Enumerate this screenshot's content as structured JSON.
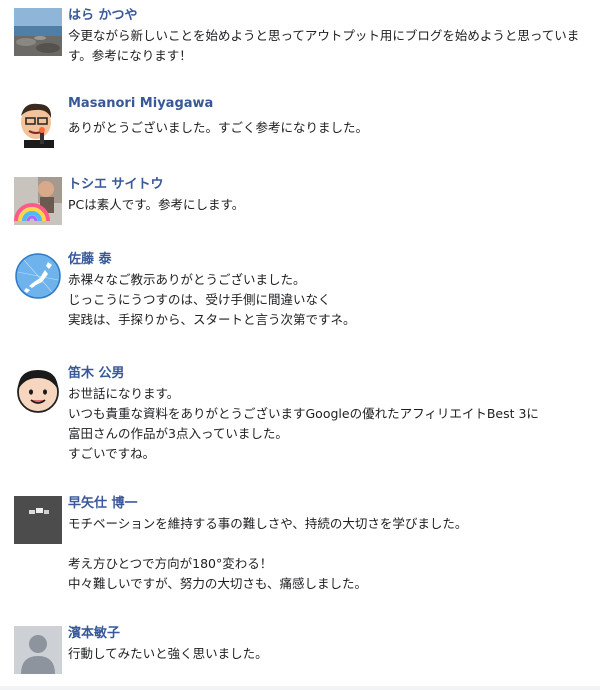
{
  "comments": [
    {
      "name": "はら かつや",
      "lines": [
        "今更ながら新しいことを始めようと思ってアウトプット用にブログを始めようと思っています。参考になります！"
      ]
    },
    {
      "name": "Masanori Miyagawa",
      "lines": [
        "ありがとうございました。すごく参考になりました。"
      ]
    },
    {
      "name": "トシエ サイトウ",
      "lines": [
        "PCは素人です。参考にします。"
      ]
    },
    {
      "name": "佐藤 泰",
      "lines": [
        "赤裸々なご教示ありがとうございました。",
        "じっこうにうつすのは、受け手側に間違いなく",
        "実践は、手探りから、スタートと言う次第ですネ。"
      ]
    },
    {
      "name": "笛木 公男",
      "lines": [
        "お世話になります。",
        "いつも貴重な資料をありがとうございますGoogleの優れたアフィリエイトBest 3に",
        "富田さんの作品が3点入っていました。",
        "すごいですね。"
      ]
    },
    {
      "name": "早矢仕 博一",
      "lines": [
        "モチベーションを維持する事の難しさや、持続の大切さを学びました。",
        "",
        "考え方ひとつで方向が180°変わる！",
        "中々難しいですが、努力の大切さも、痛感しました。"
      ]
    },
    {
      "name": "濱本敏子",
      "lines": [
        "行動してみたいと強く思いました。"
      ]
    }
  ]
}
